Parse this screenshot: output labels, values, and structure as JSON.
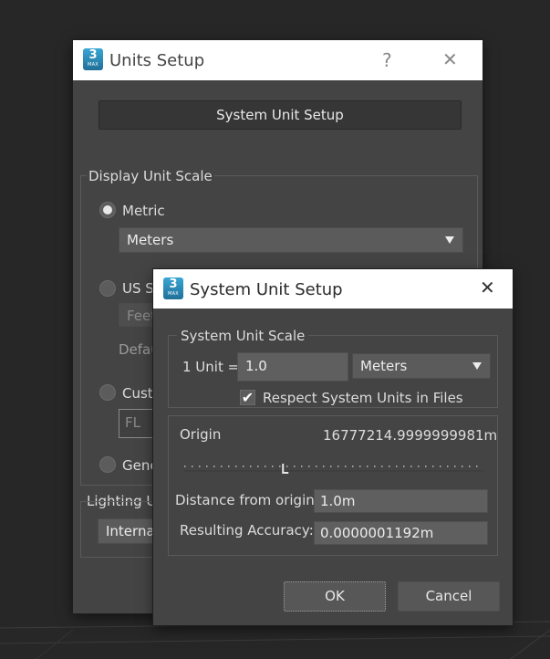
{
  "units_setup": {
    "title": "Units Setup",
    "help_glyph": "?",
    "close_glyph": "✕",
    "system_unit_setup_button": "System Unit Setup",
    "display_unit_scale": {
      "label": "Display Unit Scale",
      "metric_label": "Metric",
      "metric_value": "Meters",
      "us_standard_label": "US S",
      "us_standard_value": "Feet",
      "default_units_label": "Defau",
      "custom_label": "Cust",
      "custom_field_value": "FL",
      "generic_label": "Gene"
    },
    "lighting_units": {
      "label": "Lighting U",
      "value": "Interna"
    }
  },
  "system_unit_setup": {
    "title": "System Unit Setup",
    "close_glyph": "✕",
    "scale_group_label": "System Unit Scale",
    "one_unit_label": "1 Unit =",
    "unit_value": "1.0",
    "unit_type": "Meters",
    "respect_units_label": "Respect System Units in Files",
    "respect_units_checked": true,
    "origin_label": "Origin",
    "origin_value": "16777214.9999999981m",
    "slider_position": 0.33,
    "distance_label": "Distance from origin:",
    "distance_value": "1.0m",
    "accuracy_label": "Resulting Accuracy:",
    "accuracy_value": "0.0000001192m",
    "ok_label": "OK",
    "cancel_label": "Cancel"
  },
  "app_icon": {
    "number": "3",
    "subtext": "MAX"
  },
  "colors": {
    "dialog_bg": "#444444",
    "titlebar": "#ffffff",
    "viewport_bg": "#272727"
  }
}
